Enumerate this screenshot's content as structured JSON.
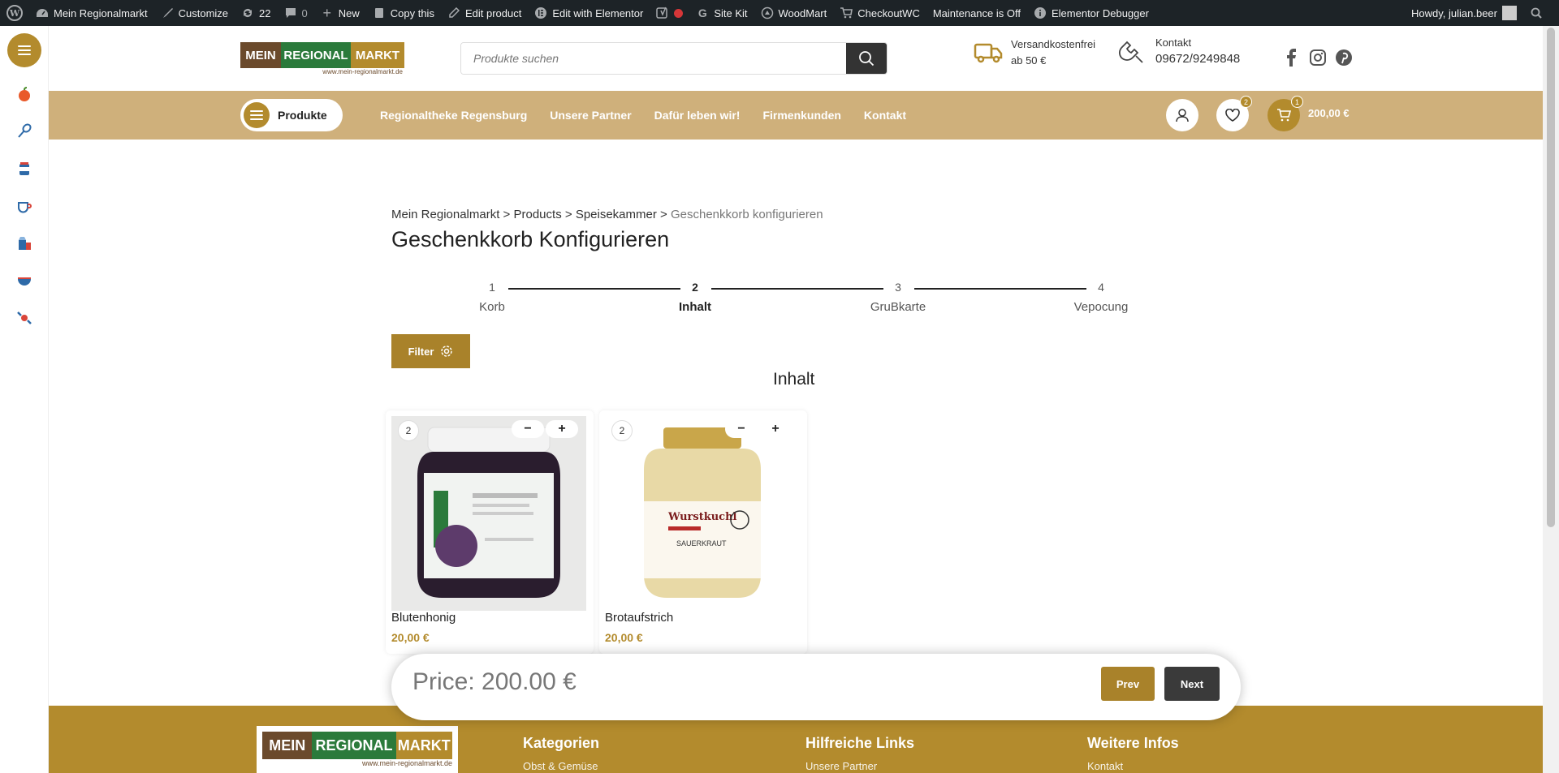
{
  "adminbar": {
    "items": [
      {
        "icon": "wordpress-icon",
        "label": ""
      },
      {
        "icon": "dashboard-icon",
        "label": "Mein Regionalmarkt"
      },
      {
        "icon": "brush-icon",
        "label": "Customize"
      },
      {
        "icon": "updates-icon",
        "label": "22"
      },
      {
        "icon": "comment-icon",
        "label": "0"
      },
      {
        "icon": "plus-icon",
        "label": "New"
      },
      {
        "icon": "copy-icon",
        "label": "Copy this"
      },
      {
        "icon": "pencil-icon",
        "label": "Edit product"
      },
      {
        "icon": "elementor-icon",
        "label": "Edit with Elementor"
      },
      {
        "icon": "yoast-icon",
        "label": ""
      },
      {
        "icon": "google-icon",
        "label": "Site Kit"
      },
      {
        "icon": "woodmart-icon",
        "label": "WoodMart"
      },
      {
        "icon": "cart-icon",
        "label": "CheckoutWC"
      },
      {
        "icon": "",
        "label": "Maintenance is Off"
      },
      {
        "icon": "info-icon",
        "label": "Elementor Debugger"
      }
    ],
    "howdy": "Howdy, julian.beer"
  },
  "header": {
    "logo": {
      "mein": "MEIN",
      "regional": "REGIONAL",
      "markt": "MARKT",
      "url": "www.mein-regionalmarkt.de"
    },
    "search_placeholder": "Produkte suchen",
    "shipping": {
      "line1": "Versandkostenfrei",
      "line2": "ab 50 €"
    },
    "contact": {
      "line1": "Kontakt",
      "line2": "09672/9249848"
    },
    "produkte_label": "Produkte",
    "nav": [
      "Regionaltheke Regensburg",
      "Unsere Partner",
      "Dafür leben wir!",
      "Firmenkunden",
      "Kontakt"
    ],
    "wishlist_count": "2",
    "cart_count": "1",
    "cart_total": "200,00 €"
  },
  "main": {
    "breadcrumb": {
      "home": "Mein Regionalmarkt",
      "sep": " > ",
      "products": "Products",
      "category": "Speisekammer",
      "current": "Geschenkkorb konfigurieren"
    },
    "title": "Geschenkkorb Konfigurieren",
    "steps": [
      {
        "num": "1",
        "label": "Korb"
      },
      {
        "num": "2",
        "label": "Inhalt"
      },
      {
        "num": "3",
        "label": "GruBkarte"
      },
      {
        "num": "4",
        "label": "Vepocung"
      }
    ],
    "filter_label": "Filter",
    "section_title": "Inhalt",
    "products": [
      {
        "qty": "2",
        "name": "Blutenhonig",
        "price": "20,00 €",
        "minus": "−",
        "plus": "+"
      },
      {
        "qty": "2",
        "name": "Brotaufstrich",
        "price": "20,00 €",
        "minus": "−",
        "plus": "+"
      }
    ],
    "price_bar": {
      "text": "Price: 200.00 €",
      "prev": "Prev",
      "next": "Next"
    }
  },
  "footer": {
    "columns": [
      {
        "title": "Kategorien",
        "link": "Obst & Gemüse"
      },
      {
        "title": "Hilfreiche Links",
        "link": "Unsere Partner"
      },
      {
        "title": "Weitere Infos",
        "link": "Kontakt"
      }
    ]
  },
  "colors": {
    "gold": "#b38b2d",
    "nav_bg": "#cfb07b",
    "adminbar": "#1d2327",
    "brown": "#6b4a2c",
    "green": "#2b7a3b"
  }
}
